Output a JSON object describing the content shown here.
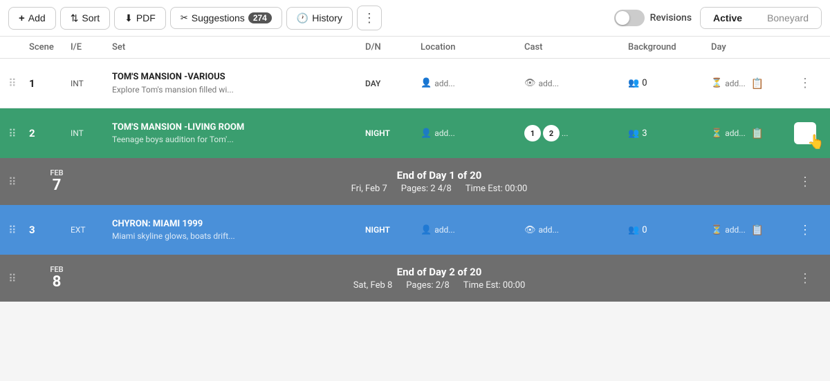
{
  "toolbar": {
    "add_label": "Add",
    "sort_label": "Sort",
    "pdf_label": "PDF",
    "suggestions_label": "Suggestions",
    "suggestions_count": "274",
    "history_label": "History",
    "revisions_label": "Revisions",
    "tab_active": "Active",
    "tab_boneyard": "Boneyard"
  },
  "columns": {
    "scene": "Scene",
    "ie": "I/E",
    "set": "Set",
    "dn": "D/N",
    "location": "Location",
    "cast": "Cast",
    "background": "Background",
    "day": "Day"
  },
  "rows": [
    {
      "type": "scene",
      "color": "white",
      "num": "1",
      "ie": "INT",
      "title": "TOM'S MANSION -VARIOUS",
      "desc": "Explore Tom's mansion filled wi...",
      "dn": "DAY",
      "location_label": "add...",
      "cast_label": "add...",
      "bg_count": "0",
      "day_label": "add..."
    },
    {
      "type": "scene",
      "color": "green",
      "num": "2",
      "ie": "INT",
      "title": "TOM'S MANSION -LIVING ROOM",
      "desc": "Teenage boys audition for Tom'...",
      "dn": "NIGHT",
      "location_label": "add...",
      "cast_avatars": [
        "1",
        "2"
      ],
      "cast_more": "...",
      "bg_count": "3",
      "day_label": "add...",
      "menu_active": true
    },
    {
      "type": "day",
      "month": "FEB",
      "daynum": "7",
      "title": "End of Day 1 of 20",
      "date_label": "Fri, Feb 7",
      "pages_label": "Pages: 2 4/8",
      "time_label": "Time Est: 00:00"
    },
    {
      "type": "scene",
      "color": "blue",
      "num": "3",
      "ie": "EXT",
      "title": "CHYRON: MIAMI 1999",
      "desc": "Miami skyline glows, boats drift...",
      "dn": "NIGHT",
      "location_label": "add...",
      "cast_label": "add...",
      "bg_count": "0",
      "day_label": "add..."
    },
    {
      "type": "day",
      "month": "FEB",
      "daynum": "8",
      "title": "End of Day 2 of 20",
      "date_label": "Sat, Feb 8",
      "pages_label": "Pages: 2/8",
      "time_label": "Time Est: 00:00"
    }
  ]
}
